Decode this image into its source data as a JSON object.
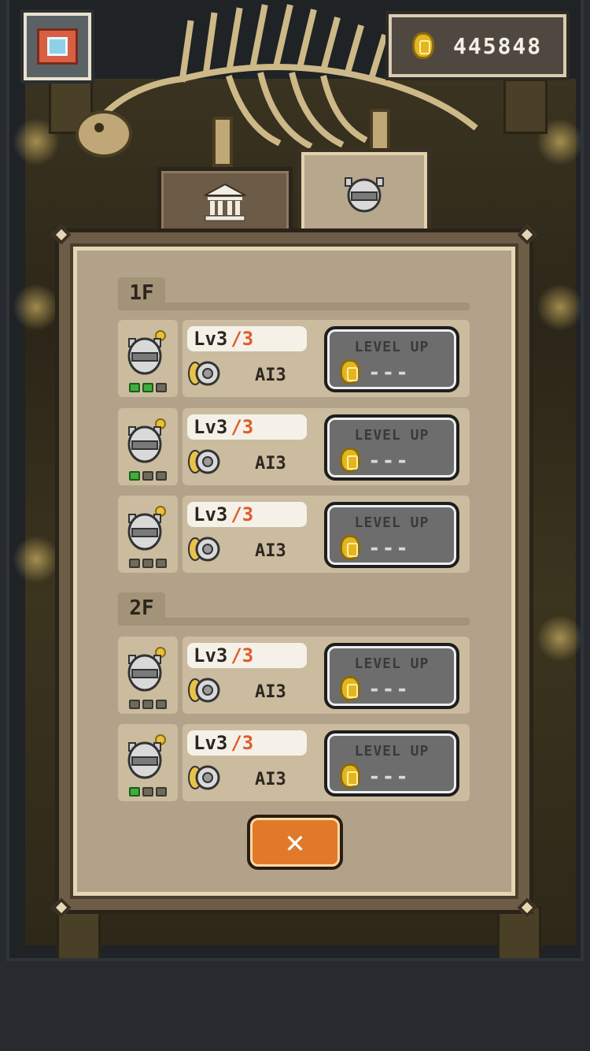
{
  "hud": {
    "coins": "445848",
    "camera_icon": "camera-icon"
  },
  "tabs": [
    {
      "icon": "museum-building-icon",
      "active": false
    },
    {
      "icon": "robot-icon",
      "active": true
    }
  ],
  "floors": [
    {
      "label": "1F",
      "robots": [
        {
          "level": "Lv3",
          "max": "/3",
          "ai": "AI3",
          "pips_on": 2,
          "button_label": "LEVEL UP",
          "cost": "---"
        },
        {
          "level": "Lv3",
          "max": "/3",
          "ai": "AI3",
          "pips_on": 1,
          "button_label": "LEVEL UP",
          "cost": "---"
        },
        {
          "level": "Lv3",
          "max": "/3",
          "ai": "AI3",
          "pips_on": 0,
          "button_label": "LEVEL UP",
          "cost": "---"
        }
      ]
    },
    {
      "label": "2F",
      "robots": [
        {
          "level": "Lv3",
          "max": "/3",
          "ai": "AI3",
          "pips_on": 0,
          "button_label": "LEVEL UP",
          "cost": "---"
        },
        {
          "level": "Lv3",
          "max": "/3",
          "ai": "AI3",
          "pips_on": 1,
          "button_label": "LEVEL UP",
          "cost": "---"
        }
      ]
    }
  ],
  "close_button": {
    "label": "✕"
  },
  "colors": {
    "accent_orange": "#e07a2a",
    "level_max": "#e05a2a",
    "pip_on": "#3fae3a"
  }
}
